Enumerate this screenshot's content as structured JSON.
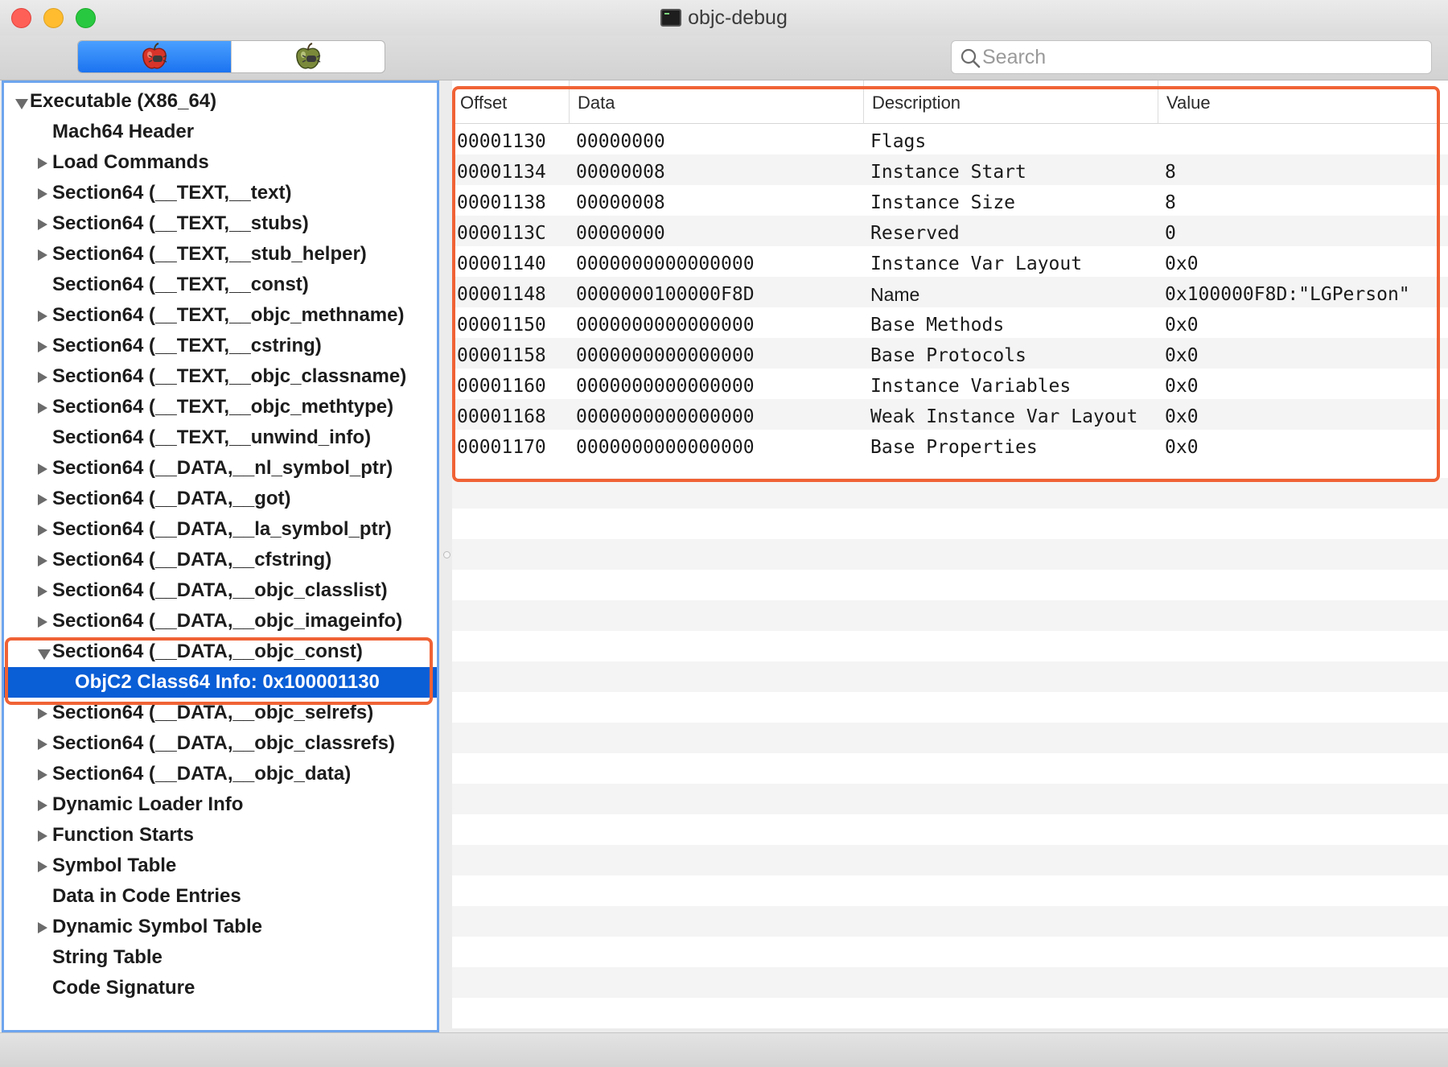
{
  "window": {
    "title": "objc-debug"
  },
  "toolbar": {
    "segments": [
      {
        "icon": "red-apple-bug-icon",
        "active": true
      },
      {
        "icon": "green-apple-bug-icon",
        "active": false
      }
    ],
    "search": {
      "placeholder": "Search",
      "value": ""
    }
  },
  "sidebar": {
    "items": [
      {
        "label": "Executable  (X86_64)",
        "level": 0,
        "disclosure": "expanded"
      },
      {
        "label": "Mach64 Header",
        "level": 1,
        "disclosure": "none"
      },
      {
        "label": "Load Commands",
        "level": 1,
        "disclosure": "collapsed"
      },
      {
        "label": "Section64 (__TEXT,__text)",
        "level": 1,
        "disclosure": "collapsed"
      },
      {
        "label": "Section64 (__TEXT,__stubs)",
        "level": 1,
        "disclosure": "collapsed"
      },
      {
        "label": "Section64 (__TEXT,__stub_helper)",
        "level": 1,
        "disclosure": "collapsed"
      },
      {
        "label": "Section64 (__TEXT,__const)",
        "level": 1,
        "disclosure": "none"
      },
      {
        "label": "Section64 (__TEXT,__objc_methname)",
        "level": 1,
        "disclosure": "collapsed"
      },
      {
        "label": "Section64 (__TEXT,__cstring)",
        "level": 1,
        "disclosure": "collapsed"
      },
      {
        "label": "Section64 (__TEXT,__objc_classname)",
        "level": 1,
        "disclosure": "collapsed"
      },
      {
        "label": "Section64 (__TEXT,__objc_methtype)",
        "level": 1,
        "disclosure": "collapsed"
      },
      {
        "label": "Section64 (__TEXT,__unwind_info)",
        "level": 1,
        "disclosure": "none"
      },
      {
        "label": "Section64 (__DATA,__nl_symbol_ptr)",
        "level": 1,
        "disclosure": "collapsed"
      },
      {
        "label": "Section64 (__DATA,__got)",
        "level": 1,
        "disclosure": "collapsed"
      },
      {
        "label": "Section64 (__DATA,__la_symbol_ptr)",
        "level": 1,
        "disclosure": "collapsed"
      },
      {
        "label": "Section64 (__DATA,__cfstring)",
        "level": 1,
        "disclosure": "collapsed"
      },
      {
        "label": "Section64 (__DATA,__objc_classlist)",
        "level": 1,
        "disclosure": "collapsed"
      },
      {
        "label": "Section64 (__DATA,__objc_imageinfo)",
        "level": 1,
        "disclosure": "collapsed"
      },
      {
        "label": "Section64 (__DATA,__objc_const)",
        "level": 1,
        "disclosure": "expanded"
      },
      {
        "label": "ObjC2 Class64 Info: 0x100001130",
        "level": 2,
        "disclosure": "none",
        "selected": true
      },
      {
        "label": "Section64 (__DATA,__objc_selrefs)",
        "level": 1,
        "disclosure": "collapsed"
      },
      {
        "label": "Section64 (__DATA,__objc_classrefs)",
        "level": 1,
        "disclosure": "collapsed"
      },
      {
        "label": "Section64 (__DATA,__objc_data)",
        "level": 1,
        "disclosure": "collapsed"
      },
      {
        "label": "Dynamic Loader Info",
        "level": 1,
        "disclosure": "collapsed"
      },
      {
        "label": "Function Starts",
        "level": 1,
        "disclosure": "collapsed"
      },
      {
        "label": "Symbol Table",
        "level": 1,
        "disclosure": "collapsed"
      },
      {
        "label": "Data in Code Entries",
        "level": 1,
        "disclosure": "none"
      },
      {
        "label": "Dynamic Symbol Table",
        "level": 1,
        "disclosure": "collapsed"
      },
      {
        "label": "String Table",
        "level": 1,
        "disclosure": "none"
      },
      {
        "label": "Code Signature",
        "level": 1,
        "disclosure": "none"
      }
    ]
  },
  "table": {
    "columns": [
      "Offset",
      "Data",
      "Description",
      "Value"
    ],
    "rows": [
      {
        "offset": "00001130",
        "data": "00000000",
        "description": "Flags",
        "value": ""
      },
      {
        "offset": "00001134",
        "data": "00000008",
        "description": "Instance Start",
        "value": "8"
      },
      {
        "offset": "00001138",
        "data": "00000008",
        "description": "Instance Size",
        "value": "8"
      },
      {
        "offset": "0000113C",
        "data": "00000000",
        "description": "Reserved",
        "value": "0"
      },
      {
        "offset": "00001140",
        "data": "0000000000000000",
        "description": "Instance Var Layout",
        "value": "0x0"
      },
      {
        "offset": "00001148",
        "data": "0000000100000F8D",
        "description": "Name",
        "value": "0x100000F8D:\"LGPerson\""
      },
      {
        "offset": "00001150",
        "data": "0000000000000000",
        "description": "Base Methods",
        "value": "0x0"
      },
      {
        "offset": "00001158",
        "data": "0000000000000000",
        "description": "Base Protocols",
        "value": "0x0"
      },
      {
        "offset": "00001160",
        "data": "0000000000000000",
        "description": "Instance Variables",
        "value": "0x0"
      },
      {
        "offset": "00001168",
        "data": "0000000000000000",
        "description": "Weak Instance Var Layout",
        "value": "0x0"
      },
      {
        "offset": "00001170",
        "data": "0000000000000000",
        "description": "Base Properties",
        "value": "0x0"
      }
    ]
  },
  "annotations": {
    "highlight_color": "#f06235"
  }
}
